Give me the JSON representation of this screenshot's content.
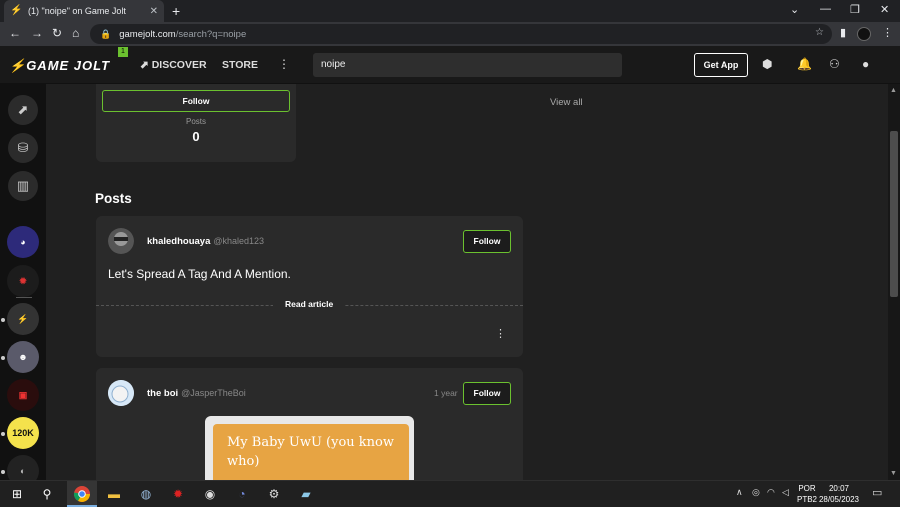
{
  "browser": {
    "tab_title": "(1) \"noipe\" on Game Jolt",
    "tab_close": "✕",
    "new_tab": "+",
    "url_host": "gamejolt.com",
    "url_path": "/search?q=noipe",
    "window_controls": [
      "⌄",
      "—",
      "❐",
      "✕"
    ]
  },
  "header": {
    "logo": "GAME JOLT",
    "notification_count": "1",
    "nav_discover": "DISCOVER",
    "nav_store": "STORE",
    "search_value": "noipe",
    "get_app": "Get App"
  },
  "sidebar": {
    "game_badge_label": "120K"
  },
  "user_card": {
    "follow_label": "Follow",
    "stat_label": "Posts",
    "stat_value": "0",
    "view_all": "View all"
  },
  "section_title": "Posts",
  "posts": [
    {
      "display_name": "khaledhouaya",
      "handle": "@khaled123",
      "follow_label": "Follow",
      "text": "Let's Spread A Tag And A Mention.",
      "read_more": "Read article"
    },
    {
      "display_name": "the boi",
      "handle": "@JasperTheBoi",
      "time": "1 year",
      "follow_label": "Follow",
      "embed_text": "My Baby UwU (you know who)"
    }
  ],
  "taskbar": {
    "lang_line1": "POR",
    "lang_line2": "PTB2",
    "time": "20:07",
    "date": "28/05/2023"
  },
  "colors": {
    "accent_green": "#6bc12f",
    "embed_orange": "#e7a443",
    "background": "#202020"
  }
}
